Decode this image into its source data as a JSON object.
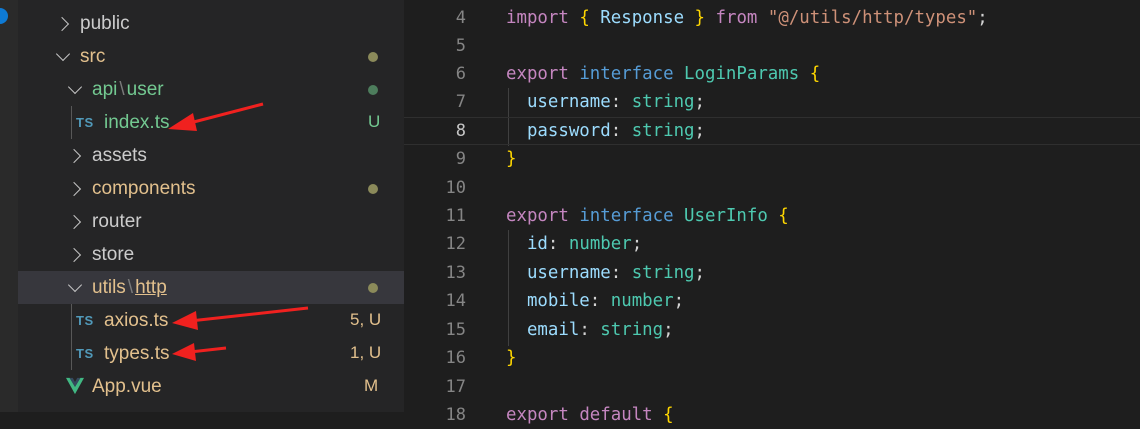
{
  "colors": {
    "modified_untracked": "#73c991",
    "modified": "#e2c08d",
    "folder_text": "#cccccc",
    "ts_icon": "#519aba",
    "vue_icon": "#41b883",
    "arrow": "#f0211f",
    "dot_olive": "#8b8a5a",
    "dot_green": "#4d7d5c"
  },
  "explorer": {
    "items": [
      {
        "id": "public",
        "label": "public",
        "icon": "chevron-right-icon"
      },
      {
        "id": "src",
        "label": "src",
        "icon": "chevron-down-icon",
        "decoration": "dot"
      },
      {
        "id": "api-user",
        "part1": "api",
        "sep": "\\",
        "part2": "user",
        "icon": "chevron-down-icon",
        "decoration": "dot"
      },
      {
        "id": "index-ts",
        "label": "index.ts",
        "icon": "typescript-file-icon",
        "icon_text": "TS",
        "status": "U"
      },
      {
        "id": "assets",
        "label": "assets",
        "icon": "chevron-right-icon"
      },
      {
        "id": "components",
        "label": "components",
        "icon": "chevron-right-icon",
        "decoration": "dot"
      },
      {
        "id": "router",
        "label": "router",
        "icon": "chevron-right-icon"
      },
      {
        "id": "store",
        "label": "store",
        "icon": "chevron-right-icon"
      },
      {
        "id": "utils-http",
        "part1": "utils",
        "sep": "\\",
        "part2": "http",
        "icon": "chevron-down-icon",
        "decoration": "dot",
        "selected": true
      },
      {
        "id": "axios-ts",
        "label": "axios.ts",
        "icon": "typescript-file-icon",
        "icon_text": "TS",
        "status": "5, U"
      },
      {
        "id": "types-ts",
        "label": "types.ts",
        "icon": "typescript-file-icon",
        "icon_text": "TS",
        "status": "1, U"
      },
      {
        "id": "app-vue",
        "label": "App.vue",
        "icon": "vue-file-icon",
        "status": "M"
      }
    ]
  },
  "editor": {
    "active_line": 8,
    "lines": [
      {
        "n": "4",
        "code": "import { Response } from \"@/utils/http/types\";"
      },
      {
        "n": "5",
        "code": ""
      },
      {
        "n": "6",
        "code": "export interface LoginParams {"
      },
      {
        "n": "7",
        "code": "  username: string;"
      },
      {
        "n": "8",
        "code": "  password: string;"
      },
      {
        "n": "9",
        "code": "}"
      },
      {
        "n": "10",
        "code": ""
      },
      {
        "n": "11",
        "code": "export interface UserInfo {"
      },
      {
        "n": "12",
        "code": "  id: number;"
      },
      {
        "n": "13",
        "code": "  username: string;"
      },
      {
        "n": "14",
        "code": "  mobile: number;"
      },
      {
        "n": "15",
        "code": "  email: string;"
      },
      {
        "n": "16",
        "code": "}"
      },
      {
        "n": "17",
        "code": ""
      },
      {
        "n": "18",
        "code": "export default {"
      }
    ]
  }
}
